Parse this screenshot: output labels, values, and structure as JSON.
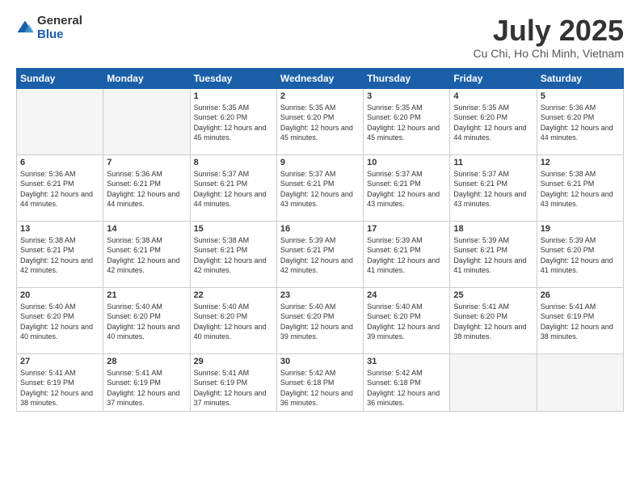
{
  "logo": {
    "general": "General",
    "blue": "Blue"
  },
  "header": {
    "month": "July 2025",
    "location": "Cu Chi, Ho Chi Minh, Vietnam"
  },
  "weekdays": [
    "Sunday",
    "Monday",
    "Tuesday",
    "Wednesday",
    "Thursday",
    "Friday",
    "Saturday"
  ],
  "weeks": [
    [
      {
        "day": "",
        "info": ""
      },
      {
        "day": "",
        "info": ""
      },
      {
        "day": "1",
        "info": "Sunrise: 5:35 AM\nSunset: 6:20 PM\nDaylight: 12 hours and 45 minutes."
      },
      {
        "day": "2",
        "info": "Sunrise: 5:35 AM\nSunset: 6:20 PM\nDaylight: 12 hours and 45 minutes."
      },
      {
        "day": "3",
        "info": "Sunrise: 5:35 AM\nSunset: 6:20 PM\nDaylight: 12 hours and 45 minutes."
      },
      {
        "day": "4",
        "info": "Sunrise: 5:35 AM\nSunset: 6:20 PM\nDaylight: 12 hours and 44 minutes."
      },
      {
        "day": "5",
        "info": "Sunrise: 5:36 AM\nSunset: 6:20 PM\nDaylight: 12 hours and 44 minutes."
      }
    ],
    [
      {
        "day": "6",
        "info": "Sunrise: 5:36 AM\nSunset: 6:21 PM\nDaylight: 12 hours and 44 minutes."
      },
      {
        "day": "7",
        "info": "Sunrise: 5:36 AM\nSunset: 6:21 PM\nDaylight: 12 hours and 44 minutes."
      },
      {
        "day": "8",
        "info": "Sunrise: 5:37 AM\nSunset: 6:21 PM\nDaylight: 12 hours and 44 minutes."
      },
      {
        "day": "9",
        "info": "Sunrise: 5:37 AM\nSunset: 6:21 PM\nDaylight: 12 hours and 43 minutes."
      },
      {
        "day": "10",
        "info": "Sunrise: 5:37 AM\nSunset: 6:21 PM\nDaylight: 12 hours and 43 minutes."
      },
      {
        "day": "11",
        "info": "Sunrise: 5:37 AM\nSunset: 6:21 PM\nDaylight: 12 hours and 43 minutes."
      },
      {
        "day": "12",
        "info": "Sunrise: 5:38 AM\nSunset: 6:21 PM\nDaylight: 12 hours and 43 minutes."
      }
    ],
    [
      {
        "day": "13",
        "info": "Sunrise: 5:38 AM\nSunset: 6:21 PM\nDaylight: 12 hours and 42 minutes."
      },
      {
        "day": "14",
        "info": "Sunrise: 5:38 AM\nSunset: 6:21 PM\nDaylight: 12 hours and 42 minutes."
      },
      {
        "day": "15",
        "info": "Sunrise: 5:38 AM\nSunset: 6:21 PM\nDaylight: 12 hours and 42 minutes."
      },
      {
        "day": "16",
        "info": "Sunrise: 5:39 AM\nSunset: 6:21 PM\nDaylight: 12 hours and 42 minutes."
      },
      {
        "day": "17",
        "info": "Sunrise: 5:39 AM\nSunset: 6:21 PM\nDaylight: 12 hours and 41 minutes."
      },
      {
        "day": "18",
        "info": "Sunrise: 5:39 AM\nSunset: 6:21 PM\nDaylight: 12 hours and 41 minutes."
      },
      {
        "day": "19",
        "info": "Sunrise: 5:39 AM\nSunset: 6:20 PM\nDaylight: 12 hours and 41 minutes."
      }
    ],
    [
      {
        "day": "20",
        "info": "Sunrise: 5:40 AM\nSunset: 6:20 PM\nDaylight: 12 hours and 40 minutes."
      },
      {
        "day": "21",
        "info": "Sunrise: 5:40 AM\nSunset: 6:20 PM\nDaylight: 12 hours and 40 minutes."
      },
      {
        "day": "22",
        "info": "Sunrise: 5:40 AM\nSunset: 6:20 PM\nDaylight: 12 hours and 40 minutes."
      },
      {
        "day": "23",
        "info": "Sunrise: 5:40 AM\nSunset: 6:20 PM\nDaylight: 12 hours and 39 minutes."
      },
      {
        "day": "24",
        "info": "Sunrise: 5:40 AM\nSunset: 6:20 PM\nDaylight: 12 hours and 39 minutes."
      },
      {
        "day": "25",
        "info": "Sunrise: 5:41 AM\nSunset: 6:20 PM\nDaylight: 12 hours and 38 minutes."
      },
      {
        "day": "26",
        "info": "Sunrise: 5:41 AM\nSunset: 6:19 PM\nDaylight: 12 hours and 38 minutes."
      }
    ],
    [
      {
        "day": "27",
        "info": "Sunrise: 5:41 AM\nSunset: 6:19 PM\nDaylight: 12 hours and 38 minutes."
      },
      {
        "day": "28",
        "info": "Sunrise: 5:41 AM\nSunset: 6:19 PM\nDaylight: 12 hours and 37 minutes."
      },
      {
        "day": "29",
        "info": "Sunrise: 5:41 AM\nSunset: 6:19 PM\nDaylight: 12 hours and 37 minutes."
      },
      {
        "day": "30",
        "info": "Sunrise: 5:42 AM\nSunset: 6:18 PM\nDaylight: 12 hours and 36 minutes."
      },
      {
        "day": "31",
        "info": "Sunrise: 5:42 AM\nSunset: 6:18 PM\nDaylight: 12 hours and 36 minutes."
      },
      {
        "day": "",
        "info": ""
      },
      {
        "day": "",
        "info": ""
      }
    ]
  ]
}
